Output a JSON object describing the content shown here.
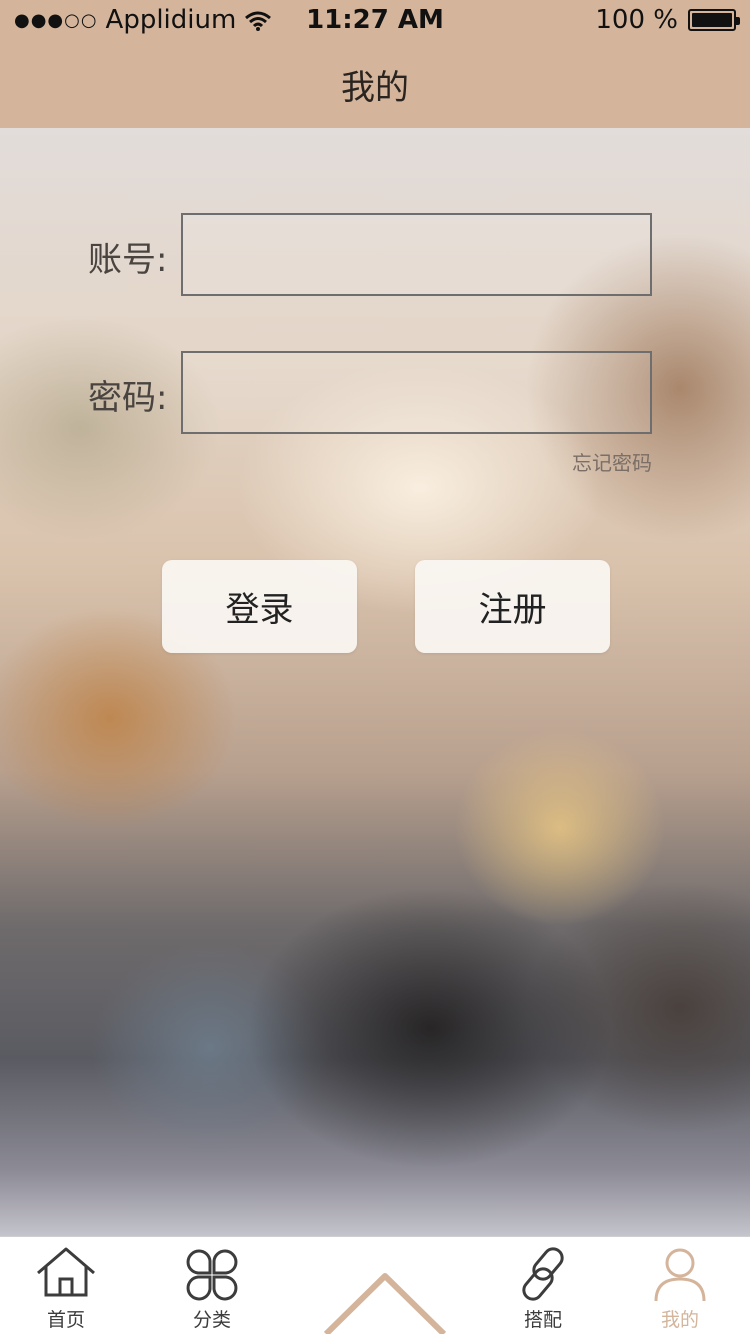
{
  "status_bar": {
    "carrier": "Applidium",
    "signal": "●●●○○",
    "time": "11:27 AM",
    "battery": "100 %"
  },
  "nav": {
    "title": "我的"
  },
  "form": {
    "account_label": "账号:",
    "account_value": "",
    "password_label": "密码:",
    "password_value": "",
    "forgot_password": "忘记密码"
  },
  "buttons": {
    "login": "登录",
    "register": "注册"
  },
  "tabs": [
    {
      "label": "首页",
      "icon": "home-icon"
    },
    {
      "label": "分类",
      "icon": "category-icon"
    },
    {
      "label": "",
      "icon": "chevron-up-icon"
    },
    {
      "label": "搭配",
      "icon": "link-icon"
    },
    {
      "label": "我的",
      "icon": "user-icon",
      "active": true
    }
  ],
  "colors": {
    "accent": "#d4b59c",
    "text": "#3c3c3c"
  }
}
